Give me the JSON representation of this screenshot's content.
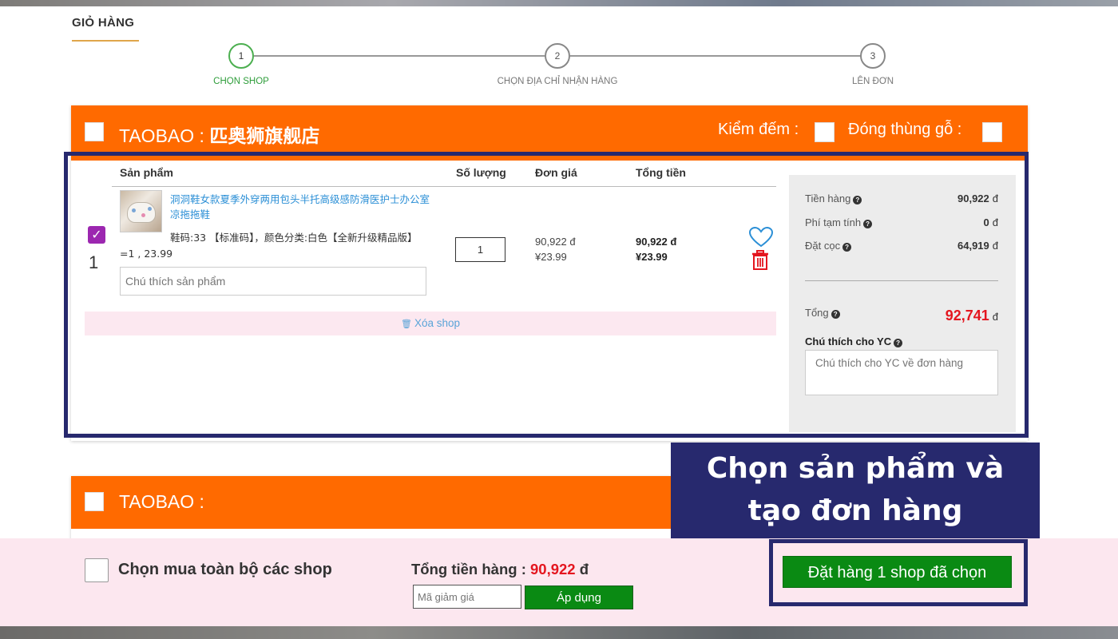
{
  "cart_title": "GIỎ HÀNG",
  "steps": [
    {
      "num": "1",
      "label": "CHỌN SHOP",
      "active": true
    },
    {
      "num": "2",
      "label": "CHỌN ĐỊA CHỈ NHẬN HÀNG",
      "active": false
    },
    {
      "num": "3",
      "label": "LÊN ĐƠN",
      "active": false
    }
  ],
  "shop": {
    "platform": "TAOBAO :",
    "name": "匹奥狮旗舰店",
    "count_label": "Kiểm đếm :",
    "crate_label": "Đóng thùng gỗ :",
    "columns": {
      "product": "Sản phẩm",
      "quantity": "Số lượng",
      "unit_price": "Đơn giá",
      "total": "Tổng tiền"
    },
    "item": {
      "index": "1",
      "checked": true,
      "title": "洞洞鞋女款夏季外穿两用包头半托高级感防滑医护士办公室凉拖拖鞋",
      "variant": "鞋码:33 【标准码】，颜色分类:白色【全新升级精品版】=1 , 23.99",
      "note_placeholder": "Chú thích sản phẩm",
      "quantity": "1",
      "unit_price_vnd": "90,922 đ",
      "unit_price_cny": "¥23.99",
      "total_vnd": "90,922 đ",
      "total_cny": "¥23.99"
    },
    "delete_shop": "Xóa shop"
  },
  "summary": {
    "goods_label": "Tiền hàng",
    "goods_value": "90,922",
    "fee_label": "Phí tạm tính",
    "fee_value": "0",
    "deposit_label": "Đặt cọc",
    "deposit_value": "64,919",
    "currency": "đ",
    "total_label": "Tổng",
    "total_value": "92,741",
    "note_label": "Chú thích cho YC",
    "note_placeholder": "Chú thích cho YC về đơn hàng"
  },
  "callout": {
    "line1": "Chọn sản phẩm và",
    "line2": "tạo đơn hàng"
  },
  "shop2": {
    "platform": "TAOBAO :"
  },
  "footer": {
    "select_all_label": "Chọn mua toàn bộ các shop",
    "total_label": "Tổng tiền hàng :",
    "total_value": "90,922",
    "currency": "đ",
    "coupon_placeholder": "Mã giảm giá",
    "apply_label": "Áp dụng",
    "order_button": "Đặt hàng 1 shop đã chọn"
  },
  "colors": {
    "accent_orange": "#ff6a00",
    "callout_navy": "#27296e",
    "button_green": "#0a8a13",
    "price_red": "#e4161f"
  }
}
